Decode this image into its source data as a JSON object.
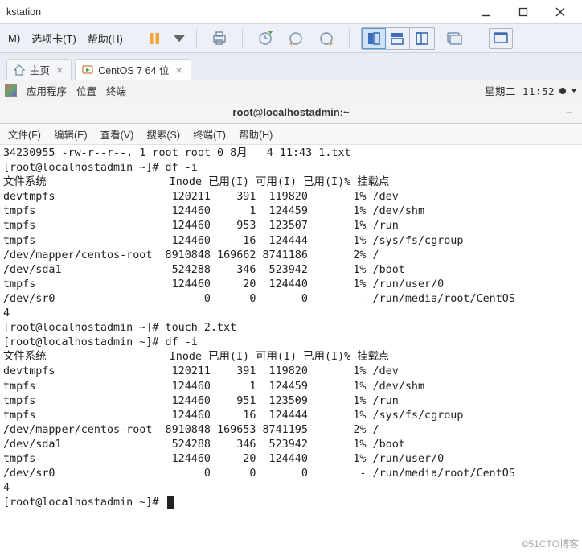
{
  "window": {
    "title": "kstation"
  },
  "menu": {
    "items": [
      "M)",
      "选项卡(T)",
      "帮助(H)"
    ]
  },
  "tool_icons": {
    "pause": "pause-icon",
    "printer": "printer-icon",
    "snapshot_clock1": "snapshot-icon",
    "snapshot_clock2": "snapshot-prev-icon",
    "snapshot_clock3": "snapshot-next-icon",
    "layout_single": "layout-single-icon",
    "layout_rows": "layout-rows-icon",
    "layout_cols": "layout-cols-icon",
    "unity": "monitor-unity-icon",
    "fullscreen": "fullscreen-icon"
  },
  "tabs": [
    {
      "label": "主页",
      "active": false
    },
    {
      "label": "CentOS 7 64 位",
      "active": true
    }
  ],
  "gnomebar": {
    "apps": "应用程序",
    "places": "位置",
    "terminal": "终端",
    "clock": "星期二 11∶52"
  },
  "term": {
    "title": "root@localhostadmin:~",
    "menu": [
      "文件(F)",
      "编辑(E)",
      "查看(V)",
      "搜索(S)",
      "终端(T)",
      "帮助(H)"
    ],
    "lines": [
      "34230955 -rw-r--r--. 1 root root 0 8月   4 11:43 1.txt",
      "[root@localhostadmin ~]# df -i",
      "文件系统                   Inode 已用(I) 可用(I) 已用(I)% 挂载点",
      "devtmpfs                  120211    391  119820       1% /dev",
      "tmpfs                     124460      1  124459       1% /dev/shm",
      "tmpfs                     124460    953  123507       1% /run",
      "tmpfs                     124460     16  124444       1% /sys/fs/cgroup",
      "/dev/mapper/centos-root  8910848 169662 8741186       2% /",
      "/dev/sda1                 524288    346  523942       1% /boot",
      "tmpfs                     124460     20  124440       1% /run/user/0",
      "/dev/sr0                       0      0       0        - /run/media/root/CentOS",
      "4",
      "[root@localhostadmin ~]# touch 2.txt",
      "[root@localhostadmin ~]# df -i",
      "文件系统                   Inode 已用(I) 可用(I) 已用(I)% 挂载点",
      "devtmpfs                  120211    391  119820       1% /dev",
      "tmpfs                     124460      1  124459       1% /dev/shm",
      "tmpfs                     124460    951  123509       1% /run",
      "tmpfs                     124460     16  124444       1% /sys/fs/cgroup",
      "/dev/mapper/centos-root  8910848 169653 8741195       2% /",
      "/dev/sda1                 524288    346  523942       1% /boot",
      "tmpfs                     124460     20  124440       1% /run/user/0",
      "/dev/sr0                       0      0       0        - /run/media/root/CentOS",
      "4",
      "[root@localhostadmin ~]# "
    ]
  },
  "watermark": "©51CTO博客"
}
